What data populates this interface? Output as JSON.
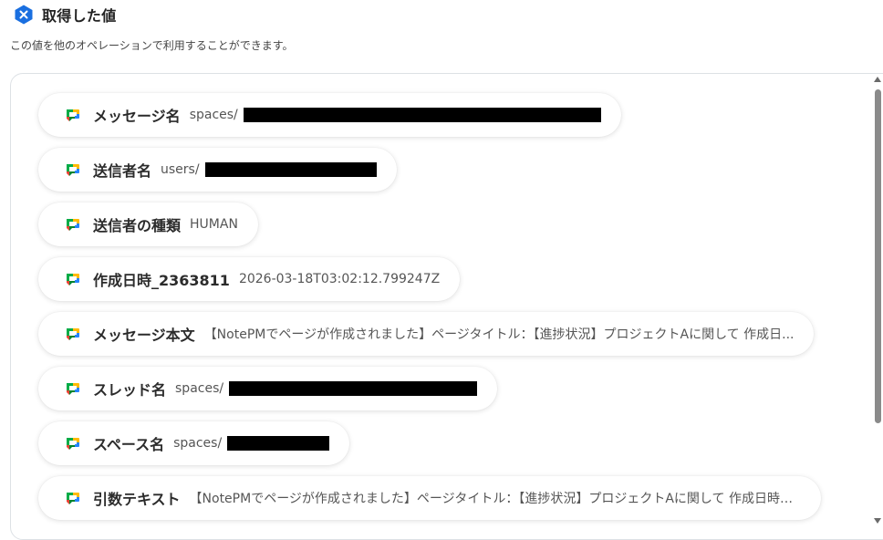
{
  "header": {
    "title": "取得した値",
    "subtitle": "この値を他のオペレーションで利用することができます。",
    "icon": "x-hexagon-icon",
    "accent": "#1a6fe0"
  },
  "fields": [
    {
      "label": "メッセージ名",
      "value": "spaces/",
      "redacted": true
    },
    {
      "label": "送信者名",
      "value": "users/",
      "redacted": true
    },
    {
      "label": "送信者の種類",
      "value": "HUMAN",
      "redacted": false
    },
    {
      "label": "作成日時_2363811",
      "value": "2026-03-18T03:02:12.799247Z",
      "redacted": false
    },
    {
      "label": "メッセージ本文",
      "value": "【NotePMでページが作成されました】ページタイトル：【進捗状況】プロジェクトAに関して 作成日...",
      "redacted": false
    },
    {
      "label": "スレッド名",
      "value": "spaces/",
      "redacted": true
    },
    {
      "label": "スペース名",
      "value": "spaces/",
      "redacted": true
    },
    {
      "label": "引数テキスト",
      "value": "【NotePMでページが作成されました】ページタイトル：【進捗状況】プロジェクトAに関して 作成日時：...",
      "redacted": false
    }
  ],
  "item_icon": "google-chat-icon"
}
